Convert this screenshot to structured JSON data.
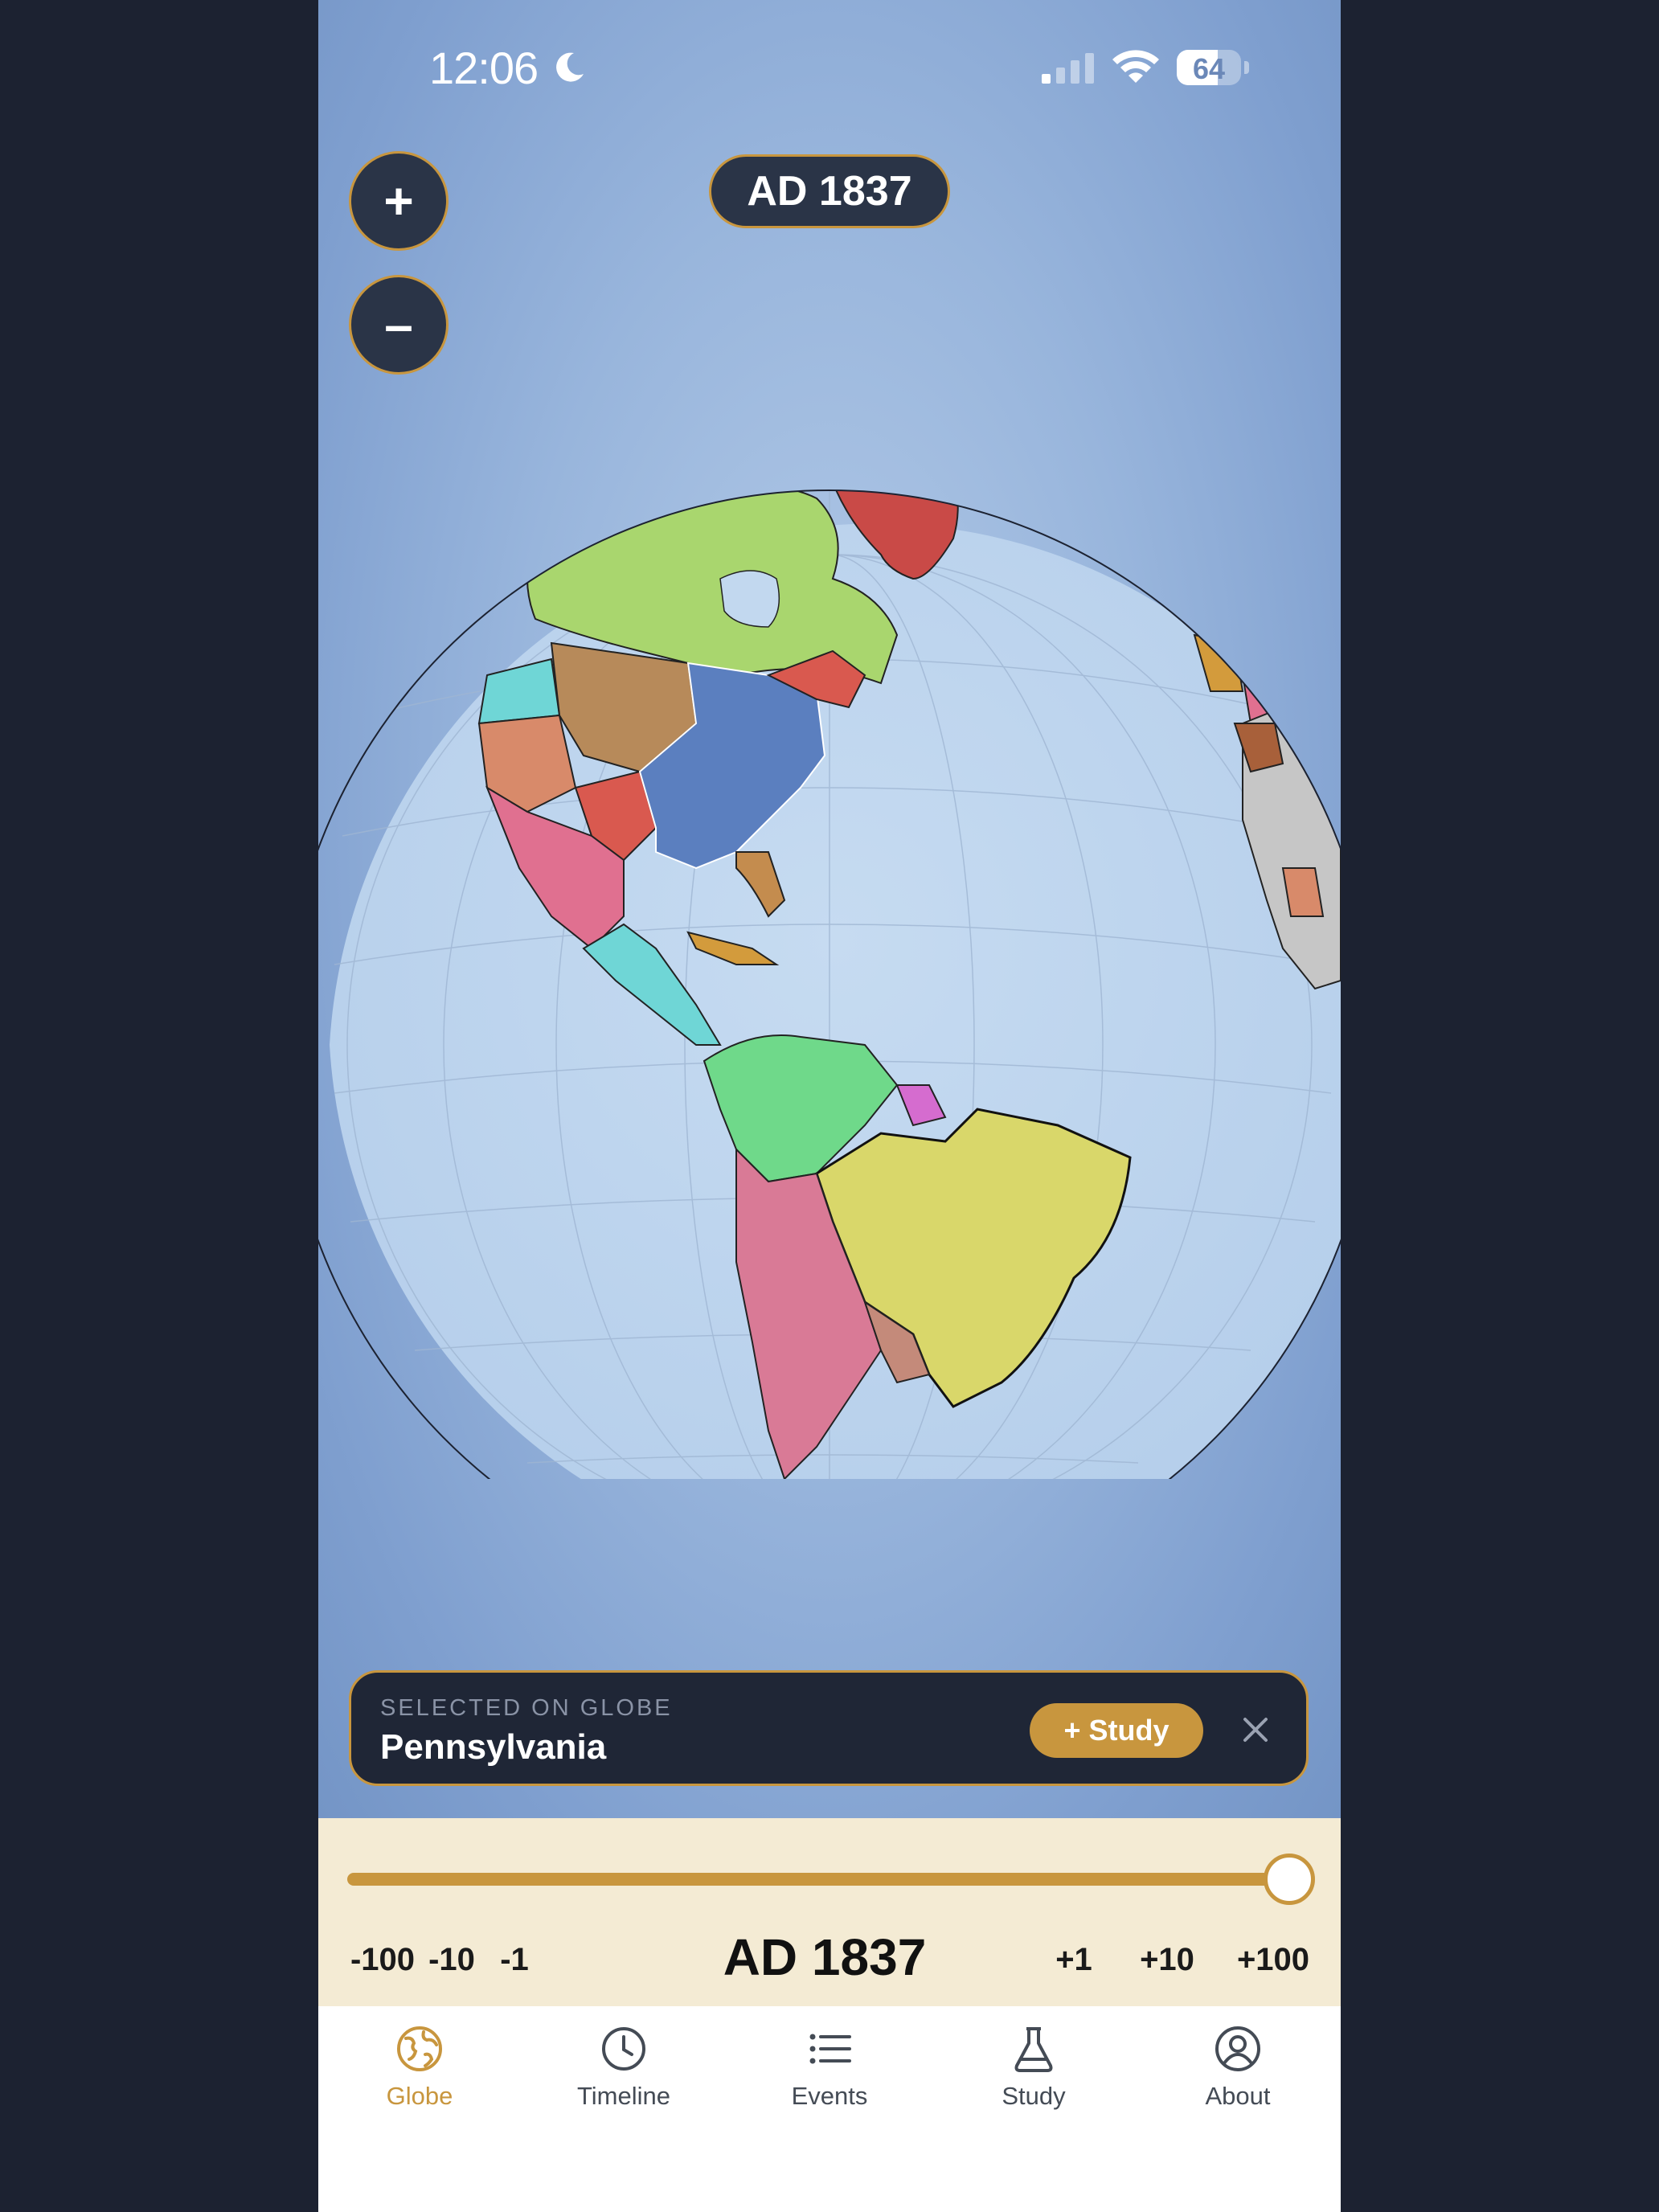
{
  "status_bar": {
    "time": "12:06",
    "battery": "64"
  },
  "map": {
    "year_label": "AD 1837",
    "zoom_in_label": "+",
    "zoom_out_label": "–"
  },
  "selection": {
    "caption": "SELECTED ON GLOBE",
    "name": "Pennsylvania",
    "study_button": "+ Study"
  },
  "time_control": {
    "steps_back": [
      "-100",
      "-10",
      "-1"
    ],
    "current_year": "AD 1837",
    "steps_forward": [
      "+1",
      "+10",
      "+100"
    ],
    "slider_position": 1.0
  },
  "tabs": [
    {
      "label": "Globe",
      "icon": "globe-icon",
      "active": true
    },
    {
      "label": "Timeline",
      "icon": "clock-icon",
      "active": false
    },
    {
      "label": "Events",
      "icon": "list-icon",
      "active": false
    },
    {
      "label": "Study",
      "icon": "flask-icon",
      "active": false
    },
    {
      "label": "About",
      "icon": "person-circle-icon",
      "active": false
    }
  ],
  "colors": {
    "accent": "#c8963e",
    "card_bg": "#1f2636",
    "panel_bg": "#f4ebd4"
  }
}
